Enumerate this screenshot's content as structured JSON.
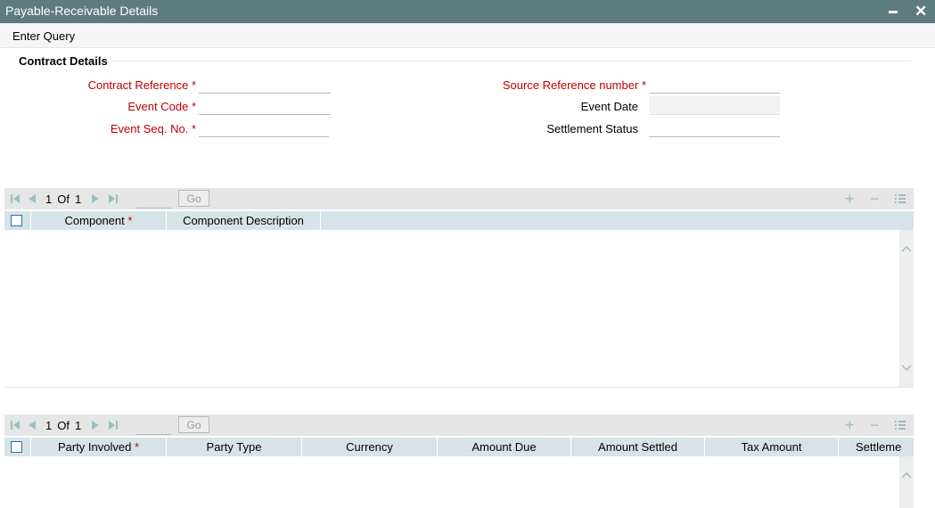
{
  "window": {
    "title": "Payable-Receivable Details",
    "close_glyph": "✕"
  },
  "menu": {
    "enter_query": "Enter Query"
  },
  "contract_details": {
    "section_title": "Contract Details",
    "contract_reference": {
      "label": "Contract Reference",
      "required": "*",
      "value": ""
    },
    "event_code": {
      "label": "Event Code",
      "required": "*",
      "value": ""
    },
    "event_seq_no": {
      "label": "Event Seq. No.",
      "required": "*",
      "value": ""
    },
    "source_reference_number": {
      "label": "Source Reference number",
      "required": "*",
      "value": ""
    },
    "event_date": {
      "label": "Event Date",
      "value": ""
    },
    "settlement_status": {
      "label": "Settlement Status",
      "value": ""
    }
  },
  "component_grid": {
    "pager": {
      "current": "1",
      "of_label": "Of",
      "total": "1",
      "go_label": "Go",
      "page_input": ""
    },
    "columns": [
      {
        "label": "Component",
        "required": "*"
      },
      {
        "label": "Component Description",
        "required": ""
      }
    ],
    "rows": []
  },
  "party_grid": {
    "pager": {
      "current": "1",
      "of_label": "Of",
      "total": "1",
      "go_label": "Go",
      "page_input": ""
    },
    "columns": [
      {
        "label": "Party Involved",
        "required": "*"
      },
      {
        "label": "Party Type",
        "required": ""
      },
      {
        "label": "Currency",
        "required": ""
      },
      {
        "label": "Amount Due",
        "required": ""
      },
      {
        "label": "Amount Settled",
        "required": ""
      },
      {
        "label": "Tax Amount",
        "required": ""
      },
      {
        "label": "Settleme",
        "required": ""
      }
    ],
    "rows": []
  },
  "icons": {
    "first_page": "first-page-icon",
    "prev_page": "prev-page-icon",
    "next_page": "next-page-icon",
    "last_page": "last-page-icon",
    "add_row": "plus-icon",
    "delete_row": "minus-icon",
    "single_view": "list-view-icon",
    "minimize": "minimize-icon",
    "close": "close-icon"
  },
  "colors": {
    "titlebar": "#5e7b7f",
    "required_label": "#c00000",
    "grid_header": "#d7e4e7",
    "nav_icon": "#9fbcc4"
  }
}
